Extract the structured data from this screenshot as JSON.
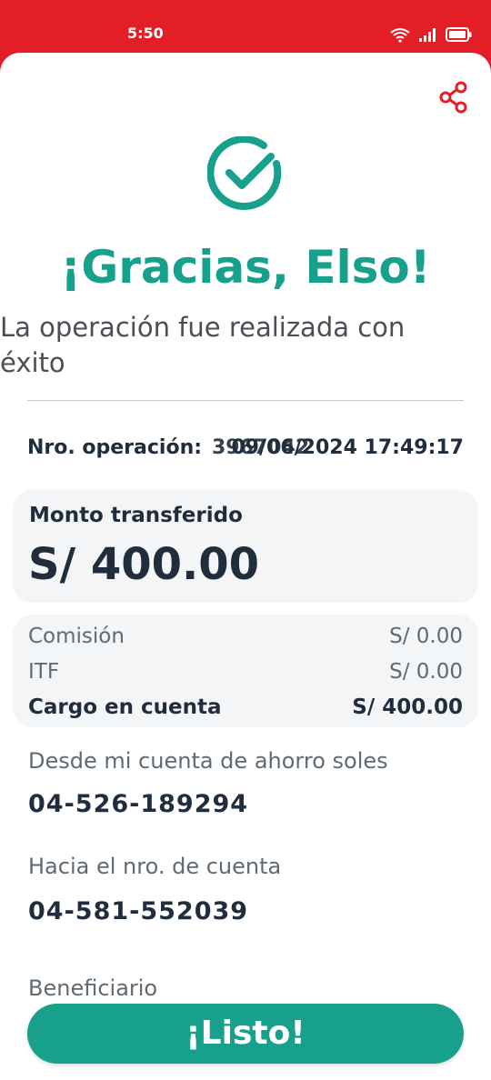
{
  "status_bar": {
    "time": "5:50"
  },
  "colors": {
    "brand_red": "#e41e26",
    "accent_teal": "#17a08b",
    "text_dark": "#1f2d3d",
    "text_muted": "#5e6b75"
  },
  "header": {
    "share_icon": "share-icon",
    "success_icon": "check-circle-icon",
    "title": "¡Gracias, Elso!",
    "subtitle": "La operación fue realizada con éxito"
  },
  "operation": {
    "label": "Nro. operación:",
    "number": "3967042",
    "datetime": "09/06/2024 17:49:17"
  },
  "amount_card": {
    "label": "Monto transferido",
    "value": "S/ 400.00"
  },
  "fees": [
    {
      "label": "Comisión",
      "value": "S/ 0.00"
    },
    {
      "label": "ITF",
      "value": "S/ 0.00"
    },
    {
      "label": "Cargo en cuenta",
      "value": "S/ 400.00"
    }
  ],
  "details": {
    "from_label": "Desde mi cuenta de ahorro soles",
    "from_account": "04-526-189294",
    "to_label": "Hacia el nro. de cuenta",
    "to_account": "04-581-552039",
    "beneficiary_label": "Beneficiario"
  },
  "actions": {
    "done_label": "¡Listo!"
  }
}
